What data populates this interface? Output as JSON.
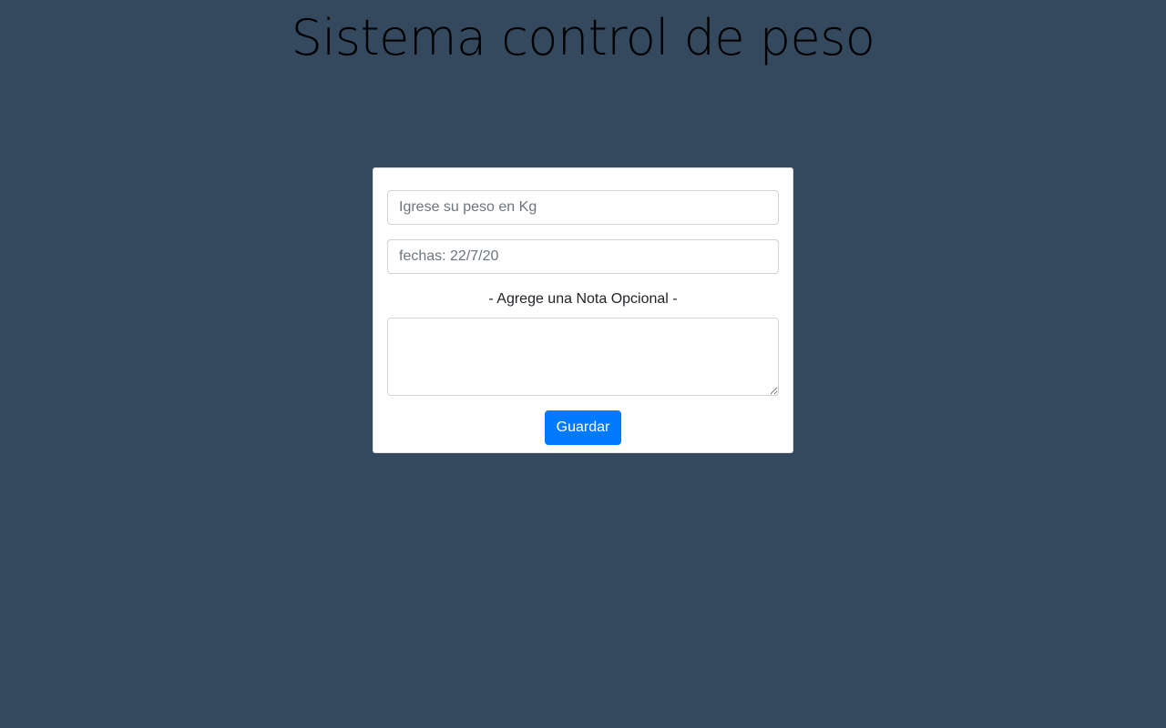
{
  "header": {
    "title": "Sistema control de peso"
  },
  "form": {
    "weight_placeholder": "Igrese su peso en Kg",
    "weight_value": "",
    "date_placeholder": "fechas: 22/7/20",
    "date_value": "",
    "note_label": "- Agrege una Nota Opcional -",
    "note_value": "",
    "save_label": "Guardar"
  },
  "colors": {
    "background": "#34495e",
    "card": "#ffffff",
    "primary": "#007bff"
  }
}
